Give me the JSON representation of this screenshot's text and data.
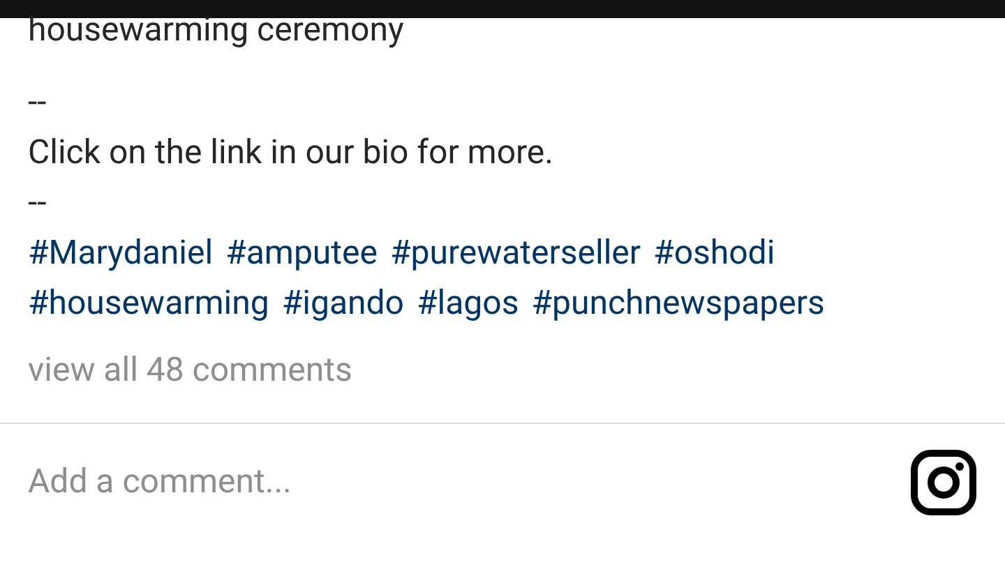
{
  "caption_tail": "housewarming ceremony",
  "separator_1": "--",
  "call_to_action": "Click on the link in our bio for more.",
  "separator_2": "--",
  "hashtag_lines": [
    [
      "#Marydaniel",
      "#amputee",
      "#purewaterseller",
      "#oshodi"
    ],
    [
      "#housewarming",
      "#igando",
      "#lagos",
      "#punchnewspapers"
    ]
  ],
  "view_comments": "view all 48 comments",
  "comment_field": {
    "placeholder": "Add a comment..."
  }
}
